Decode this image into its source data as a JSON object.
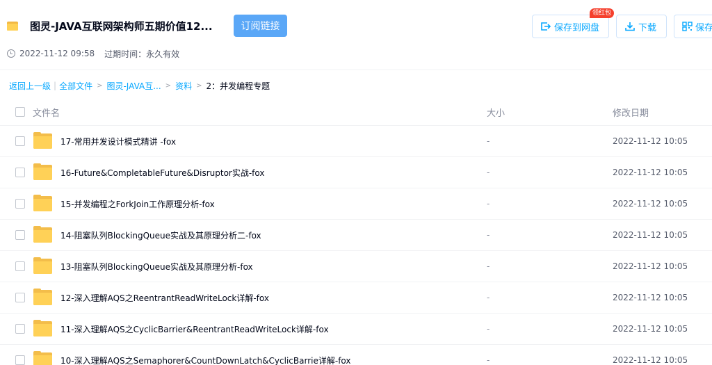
{
  "header": {
    "share_title": "图灵-JAVA互联网架构师五期价值12...",
    "subscribe_label": "订阅链接",
    "created_time": "2022-11-12 09:58",
    "expire_text": "过期时间：永久有效",
    "save_label": "保存到网盘",
    "badge_label": "领红包",
    "download_label": "下载",
    "more_label": "保存"
  },
  "breadcrumb": {
    "back": "返回上一级",
    "all_files": "全部文件",
    "sep": ">",
    "crumb1": "图灵-JAVA互...",
    "crumb2": "资料",
    "current": "2：并发编程专题"
  },
  "table": {
    "col_name": "文件名",
    "col_size": "大小",
    "col_date": "修改日期",
    "rows": [
      {
        "name": "17-常用并发设计模式精讲 -fox",
        "size": "-",
        "date": "2022-11-12 10:05"
      },
      {
        "name": "16-Future&CompletableFuture&Disruptor实战-fox",
        "size": "-",
        "date": "2022-11-12 10:05"
      },
      {
        "name": "15-并发编程之ForkJoin工作原理分析-fox",
        "size": "-",
        "date": "2022-11-12 10:05"
      },
      {
        "name": "14-阻塞队列BlockingQueue实战及其原理分析二-fox",
        "size": "-",
        "date": "2022-11-12 10:05"
      },
      {
        "name": "13-阻塞队列BlockingQueue实战及其原理分析-fox",
        "size": "-",
        "date": "2022-11-12 10:05"
      },
      {
        "name": "12-深入理解AQS之ReentrantReadWriteLock详解-fox",
        "size": "-",
        "date": "2022-11-12 10:05"
      },
      {
        "name": "11-深入理解AQS之CyclicBarrier&ReentrantReadWriteLock详解-fox",
        "size": "-",
        "date": "2022-11-12 10:05"
      },
      {
        "name": "10-深入理解AQS之Semaphorer&CountDownLatch&CyclicBarrie详解-fox",
        "size": "-",
        "date": "2022-11-12 10:05"
      }
    ]
  },
  "colors": {
    "accent": "#06a7ff",
    "subscribe_bg": "#5aa7f7",
    "folder": "#ffd157",
    "badge": "#f5402d"
  },
  "icons": [
    "folder-icon",
    "clock-icon",
    "save-to-disk-icon",
    "download-icon",
    "qr-save-icon"
  ]
}
